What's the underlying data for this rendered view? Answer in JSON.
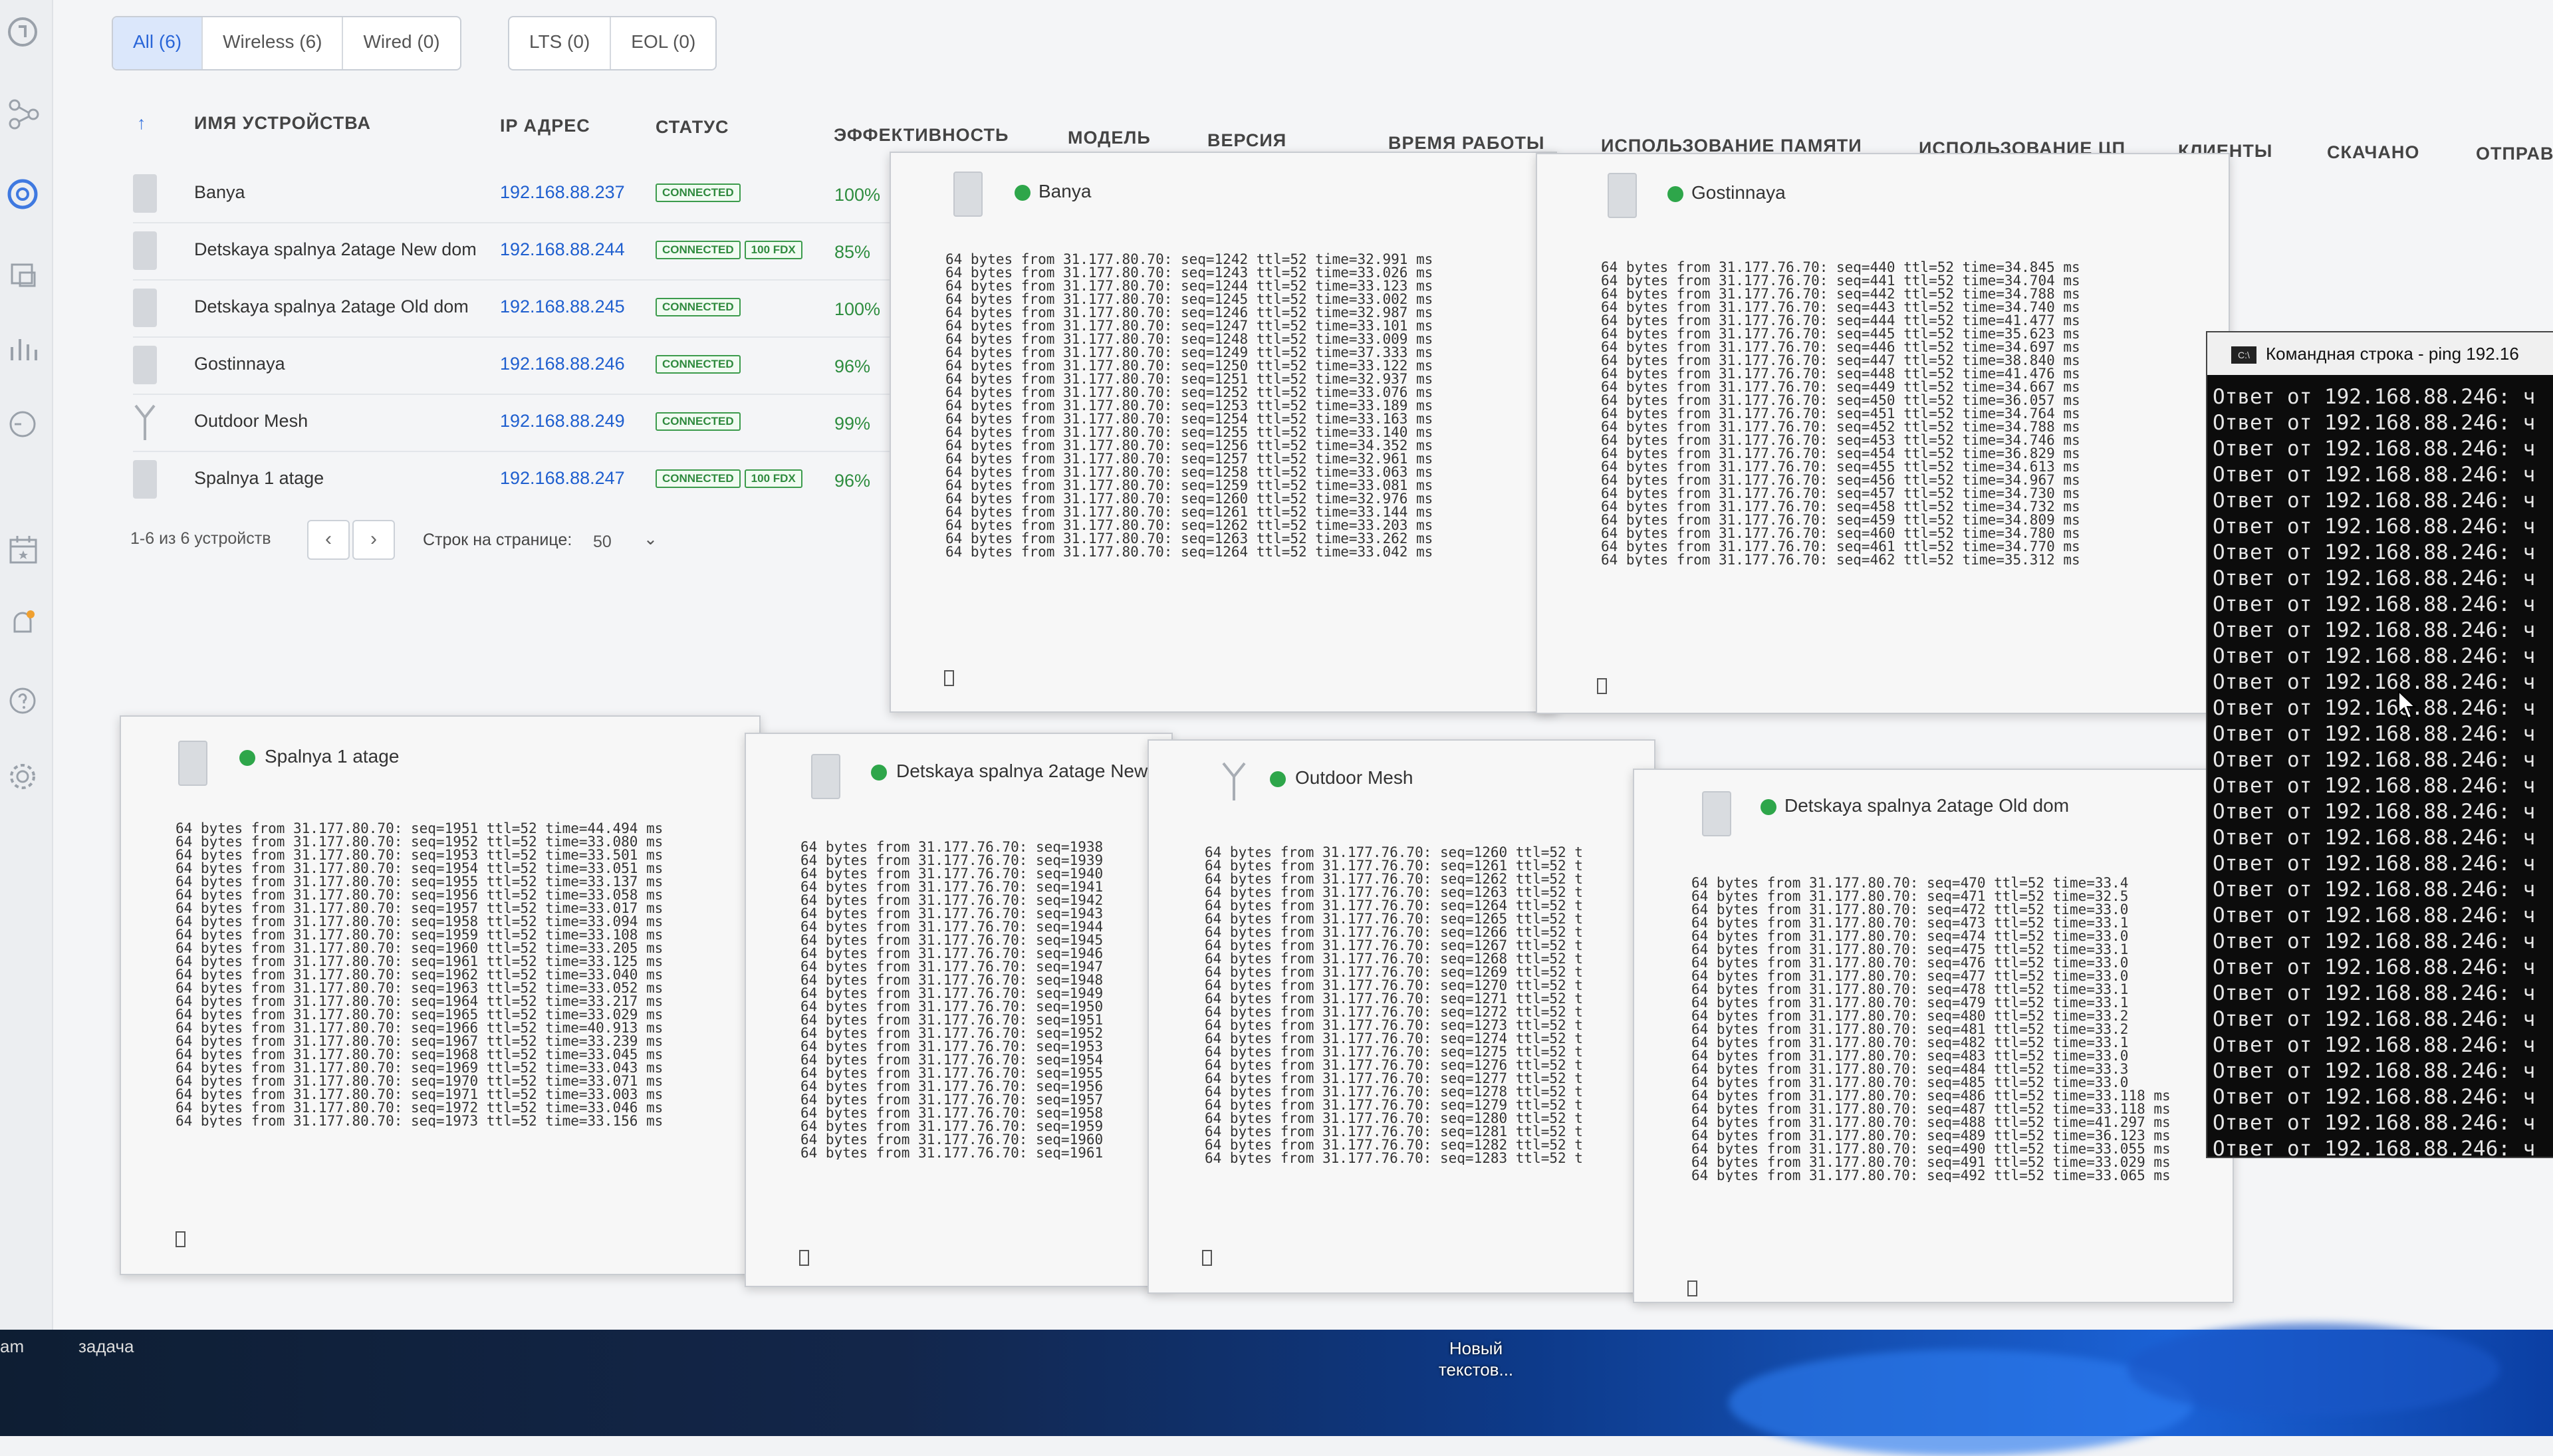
{
  "filters": {
    "all": "All (6)",
    "wireless": "Wireless (6)",
    "wired": "Wired (0)",
    "lts": "LTS (0)",
    "eol": "EOL (0)"
  },
  "table": {
    "sort_indicator": "↑",
    "columns": {
      "name": "ИМЯ УСТРОЙСТВА",
      "ip": "IP АДРЕС",
      "status": "СТАТУС",
      "efficiency": "ЭФФЕКТИВНОСТЬ",
      "model": "МОДЕЛЬ",
      "version": "ВЕРСИЯ",
      "uptime": "ВРЕМЯ РАБОТЫ",
      "memory": "ИСПОЛЬЗОВАНИЕ ПАМЯТИ",
      "cpu": "ИСПОЛЬЗОВАНИЕ ЦП",
      "clients": "КЛИЕНТЫ",
      "speed": "СКАЧАНО",
      "sent": "ОТПРАВ"
    },
    "rows": [
      {
        "name": "Banya",
        "ip": "192.168.88.237",
        "status": "CONNECTED",
        "extra": "",
        "efficiency": "100%"
      },
      {
        "name": "Detskaya spalnya 2atage New dom",
        "ip": "192.168.88.244",
        "status": "CONNECTED",
        "extra": "100 FDX",
        "efficiency": "85%"
      },
      {
        "name": "Detskaya spalnya 2atage Old dom",
        "ip": "192.168.88.245",
        "status": "CONNECTED",
        "extra": "",
        "efficiency": "100%"
      },
      {
        "name": "Gostinnaya",
        "ip": "192.168.88.246",
        "status": "CONNECTED",
        "extra": "",
        "efficiency": "96%"
      },
      {
        "name": "Outdoor Mesh",
        "ip": "192.168.88.249",
        "status": "CONNECTED",
        "extra": "",
        "efficiency": "99%"
      },
      {
        "name": "Spalnya 1 atage",
        "ip": "192.168.88.247",
        "status": "CONNECTED",
        "extra": "100 FDX",
        "efficiency": "96%"
      }
    ]
  },
  "pager": {
    "count": "1-6 из 6 устройств",
    "prev": "‹",
    "next": "›",
    "rows_label": "Строк на странице:",
    "rows_value": "50",
    "dropdown": "⌄"
  },
  "terminals": {
    "banya": {
      "title": "Banya",
      "lines": "64 bytes from 31.177.80.70: seq=1242 ttl=52 time=32.991 ms\n64 bytes from 31.177.80.70: seq=1243 ttl=52 time=33.026 ms\n64 bytes from 31.177.80.70: seq=1244 ttl=52 time=33.123 ms\n64 bytes from 31.177.80.70: seq=1245 ttl=52 time=33.002 ms\n64 bytes from 31.177.80.70: seq=1246 ttl=52 time=32.987 ms\n64 bytes from 31.177.80.70: seq=1247 ttl=52 time=33.101 ms\n64 bytes from 31.177.80.70: seq=1248 ttl=52 time=33.009 ms\n64 bytes from 31.177.80.70: seq=1249 ttl=52 time=37.333 ms\n64 bytes from 31.177.80.70: seq=1250 ttl=52 time=33.122 ms\n64 bytes from 31.177.80.70: seq=1251 ttl=52 time=32.937 ms\n64 bytes from 31.177.80.70: seq=1252 ttl=52 time=33.076 ms\n64 bytes from 31.177.80.70: seq=1253 ttl=52 time=33.189 ms\n64 bytes from 31.177.80.70: seq=1254 ttl=52 time=33.163 ms\n64 bytes from 31.177.80.70: seq=1255 ttl=52 time=33.140 ms\n64 bytes from 31.177.80.70: seq=1256 ttl=52 time=34.352 ms\n64 bytes from 31.177.80.70: seq=1257 ttl=52 time=32.961 ms\n64 bytes from 31.177.80.70: seq=1258 ttl=52 time=33.063 ms\n64 bytes from 31.177.80.70: seq=1259 ttl=52 time=33.081 ms\n64 bytes from 31.177.80.70: seq=1260 ttl=52 time=32.976 ms\n64 bytes from 31.177.80.70: seq=1261 ttl=52 time=33.144 ms\n64 bytes from 31.177.80.70: seq=1262 ttl=52 time=33.203 ms\n64 bytes from 31.177.80.70: seq=1263 ttl=52 time=33.262 ms\n64 bytes from 31.177.80.70: seq=1264 ttl=52 time=33.042 ms"
    },
    "gostinnaya": {
      "title": "Gostinnaya",
      "lines": "64 bytes from 31.177.76.70: seq=440 ttl=52 time=34.845 ms\n64 bytes from 31.177.76.70: seq=441 ttl=52 time=34.704 ms\n64 bytes from 31.177.76.70: seq=442 ttl=52 time=34.788 ms\n64 bytes from 31.177.76.70: seq=443 ttl=52 time=34.740 ms\n64 bytes from 31.177.76.70: seq=444 ttl=52 time=41.477 ms\n64 bytes from 31.177.76.70: seq=445 ttl=52 time=35.623 ms\n64 bytes from 31.177.76.70: seq=446 ttl=52 time=34.697 ms\n64 bytes from 31.177.76.70: seq=447 ttl=52 time=38.840 ms\n64 bytes from 31.177.76.70: seq=448 ttl=52 time=41.476 ms\n64 bytes from 31.177.76.70: seq=449 ttl=52 time=34.667 ms\n64 bytes from 31.177.76.70: seq=450 ttl=52 time=36.057 ms\n64 bytes from 31.177.76.70: seq=451 ttl=52 time=34.764 ms\n64 bytes from 31.177.76.70: seq=452 ttl=52 time=34.788 ms\n64 bytes from 31.177.76.70: seq=453 ttl=52 time=34.746 ms\n64 bytes from 31.177.76.70: seq=454 ttl=52 time=36.829 ms\n64 bytes from 31.177.76.70: seq=455 ttl=52 time=34.613 ms\n64 bytes from 31.177.76.70: seq=456 ttl=52 time=34.967 ms\n64 bytes from 31.177.76.70: seq=457 ttl=52 time=34.730 ms\n64 bytes from 31.177.76.70: seq=458 ttl=52 time=34.732 ms\n64 bytes from 31.177.76.70: seq=459 ttl=52 time=34.809 ms\n64 bytes from 31.177.76.70: seq=460 ttl=52 time=34.780 ms\n64 bytes from 31.177.76.70: seq=461 ttl=52 time=34.770 ms\n64 bytes from 31.177.76.70: seq=462 ttl=52 time=35.312 ms"
    },
    "spalnya": {
      "title": "Spalnya 1 atage",
      "lines": "64 bytes from 31.177.80.70: seq=1951 ttl=52 time=44.494 ms\n64 bytes from 31.177.80.70: seq=1952 ttl=52 time=33.080 ms\n64 bytes from 31.177.80.70: seq=1953 ttl=52 time=33.501 ms\n64 bytes from 31.177.80.70: seq=1954 ttl=52 time=33.051 ms\n64 bytes from 31.177.80.70: seq=1955 ttl=52 time=33.137 ms\n64 bytes from 31.177.80.70: seq=1956 ttl=52 time=33.058 ms\n64 bytes from 31.177.80.70: seq=1957 ttl=52 time=33.017 ms\n64 bytes from 31.177.80.70: seq=1958 ttl=52 time=33.094 ms\n64 bytes from 31.177.80.70: seq=1959 ttl=52 time=33.108 ms\n64 bytes from 31.177.80.70: seq=1960 ttl=52 time=33.205 ms\n64 bytes from 31.177.80.70: seq=1961 ttl=52 time=33.125 ms\n64 bytes from 31.177.80.70: seq=1962 ttl=52 time=33.040 ms\n64 bytes from 31.177.80.70: seq=1963 ttl=52 time=33.052 ms\n64 bytes from 31.177.80.70: seq=1964 ttl=52 time=33.217 ms\n64 bytes from 31.177.80.70: seq=1965 ttl=52 time=33.029 ms\n64 bytes from 31.177.80.70: seq=1966 ttl=52 time=40.913 ms\n64 bytes from 31.177.80.70: seq=1967 ttl=52 time=33.239 ms\n64 bytes from 31.177.80.70: seq=1968 ttl=52 time=33.045 ms\n64 bytes from 31.177.80.70: seq=1969 ttl=52 time=33.043 ms\n64 bytes from 31.177.80.70: seq=1970 ttl=52 time=33.071 ms\n64 bytes from 31.177.80.70: seq=1971 ttl=52 time=33.003 ms\n64 bytes from 31.177.80.70: seq=1972 ttl=52 time=33.046 ms\n64 bytes from 31.177.80.70: seq=1973 ttl=52 time=33.156 ms"
    },
    "detskaya_new": {
      "title": "Detskaya spalnya 2atage New",
      "lines": "64 bytes from 31.177.76.70: seq=1938\n64 bytes from 31.177.76.70: seq=1939\n64 bytes from 31.177.76.70: seq=1940\n64 bytes from 31.177.76.70: seq=1941\n64 bytes from 31.177.76.70: seq=1942\n64 bytes from 31.177.76.70: seq=1943\n64 bytes from 31.177.76.70: seq=1944\n64 bytes from 31.177.76.70: seq=1945\n64 bytes from 31.177.76.70: seq=1946\n64 bytes from 31.177.76.70: seq=1947\n64 bytes from 31.177.76.70: seq=1948\n64 bytes from 31.177.76.70: seq=1949\n64 bytes from 31.177.76.70: seq=1950\n64 bytes from 31.177.76.70: seq=1951\n64 bytes from 31.177.76.70: seq=1952\n64 bytes from 31.177.76.70: seq=1953\n64 bytes from 31.177.76.70: seq=1954\n64 bytes from 31.177.76.70: seq=1955\n64 bytes from 31.177.76.70: seq=1956\n64 bytes from 31.177.76.70: seq=1957\n64 bytes from 31.177.76.70: seq=1958\n64 bytes from 31.177.76.70: seq=1959\n64 bytes from 31.177.76.70: seq=1960\n64 bytes from 31.177.76.70: seq=1961"
    },
    "outdoor": {
      "title": "Outdoor Mesh",
      "lines": "64 bytes from 31.177.76.70: seq=1260 ttl=52 t\n64 bytes from 31.177.76.70: seq=1261 ttl=52 t\n64 bytes from 31.177.76.70: seq=1262 ttl=52 t\n64 bytes from 31.177.76.70: seq=1263 ttl=52 t\n64 bytes from 31.177.76.70: seq=1264 ttl=52 t\n64 bytes from 31.177.76.70: seq=1265 ttl=52 t\n64 bytes from 31.177.76.70: seq=1266 ttl=52 t\n64 bytes from 31.177.76.70: seq=1267 ttl=52 t\n64 bytes from 31.177.76.70: seq=1268 ttl=52 t\n64 bytes from 31.177.76.70: seq=1269 ttl=52 t\n64 bytes from 31.177.76.70: seq=1270 ttl=52 t\n64 bytes from 31.177.76.70: seq=1271 ttl=52 t\n64 bytes from 31.177.76.70: seq=1272 ttl=52 t\n64 bytes from 31.177.76.70: seq=1273 ttl=52 t\n64 bytes from 31.177.76.70: seq=1274 ttl=52 t\n64 bytes from 31.177.76.70: seq=1275 ttl=52 t\n64 bytes from 31.177.76.70: seq=1276 ttl=52 t\n64 bytes from 31.177.76.70: seq=1277 ttl=52 t\n64 bytes from 31.177.76.70: seq=1278 ttl=52 t\n64 bytes from 31.177.76.70: seq=1279 ttl=52 t\n64 bytes from 31.177.76.70: seq=1280 ttl=52 t\n64 bytes from 31.177.76.70: seq=1281 ttl=52 t\n64 bytes from 31.177.76.70: seq=1282 ttl=52 t\n64 bytes from 31.177.76.70: seq=1283 ttl=52 t"
    },
    "detskaya_old": {
      "title": "Detskaya spalnya 2atage Old dom",
      "lines": "64 bytes from 31.177.80.70: seq=470 ttl=52 time=33.4\n64 bytes from 31.177.80.70: seq=471 ttl=52 time=32.5\n64 bytes from 31.177.80.70: seq=472 ttl=52 time=33.0\n64 bytes from 31.177.80.70: seq=473 ttl=52 time=33.1\n64 bytes from 31.177.80.70: seq=474 ttl=52 time=33.0\n64 bytes from 31.177.80.70: seq=475 ttl=52 time=33.1\n64 bytes from 31.177.80.70: seq=476 ttl=52 time=33.0\n64 bytes from 31.177.80.70: seq=477 ttl=52 time=33.0\n64 bytes from 31.177.80.70: seq=478 ttl=52 time=33.1\n64 bytes from 31.177.80.70: seq=479 ttl=52 time=33.1\n64 bytes from 31.177.80.70: seq=480 ttl=52 time=33.2\n64 bytes from 31.177.80.70: seq=481 ttl=52 time=33.2\n64 bytes from 31.177.80.70: seq=482 ttl=52 time=33.1\n64 bytes from 31.177.80.70: seq=483 ttl=52 time=33.0\n64 bytes from 31.177.80.70: seq=484 ttl=52 time=33.3\n64 bytes from 31.177.80.70: seq=485 ttl=52 time=33.0\n64 bytes from 31.177.80.70: seq=486 ttl=52 time=33.118 ms\n64 bytes from 31.177.80.70: seq=487 ttl=52 time=33.118 ms\n64 bytes from 31.177.80.70: seq=488 ttl=52 time=41.297 ms\n64 bytes from 31.177.80.70: seq=489 ttl=52 time=36.123 ms\n64 bytes from 31.177.80.70: seq=490 ttl=52 time=33.055 ms\n64 bytes from 31.177.80.70: seq=491 ttl=52 time=33.029 ms\n64 bytes from 31.177.80.70: seq=492 ttl=52 time=33.065 ms"
    }
  },
  "cmd": {
    "title": "Командная строка - ping 192.16",
    "line": "Ответ от 192.168.88.246: ч",
    "line_count": 34
  },
  "desktop": {
    "icon_label_1": "Новый",
    "icon_label_2": "текстов...",
    "taskbar_a": "am",
    "taskbar_b": "задача"
  },
  "colors": {
    "accent_blue": "#1f5fcf",
    "connected_green": "#2e8d3f",
    "online_dot": "#2ea64a"
  }
}
